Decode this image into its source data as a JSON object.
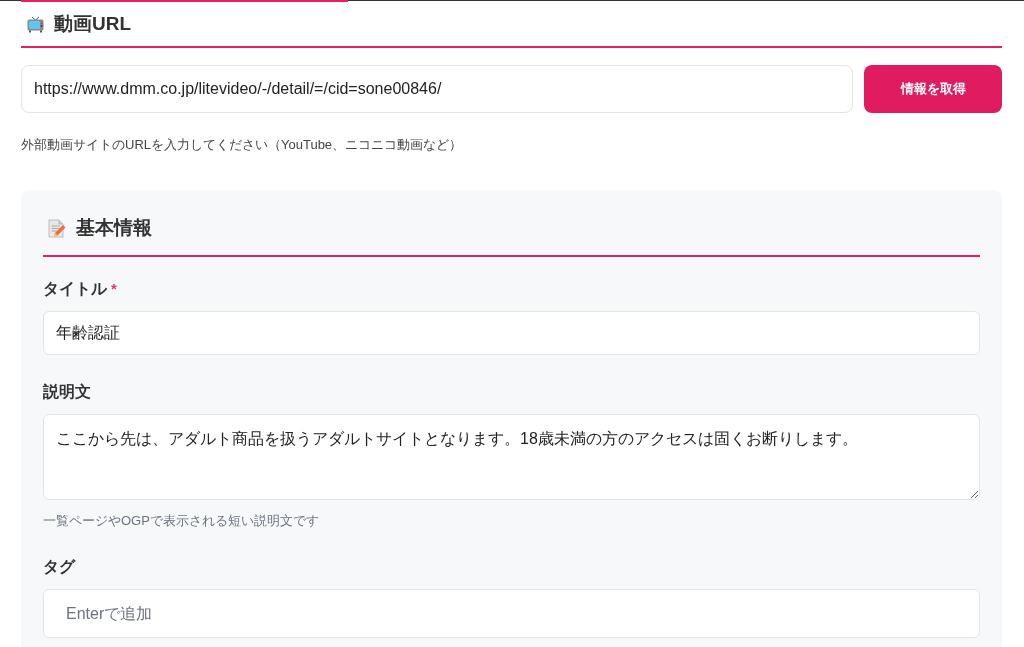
{
  "url_section": {
    "title": "動画URL",
    "url_field": {
      "value": "https://www.dmm.co.jp/litevideo/-/detail/=/cid=sone00846/"
    },
    "fetch_button": "情報を取得",
    "help": "外部動画サイトのURLを入力してください（YouTube、ニコニコ動画など）"
  },
  "basic_info": {
    "title": "基本情報",
    "fields": [
      {
        "kind": "text",
        "label": "タイトル",
        "required_mark": "*",
        "value": "年齢認証"
      },
      {
        "kind": "textarea",
        "label": "説明文",
        "value": "ここから先は、アダルト商品を扱うアダルトサイトとなります。18歳未満の方のアクセスは固くお断りします。",
        "help": "一覧ページやOGPで表示される短い説明文です"
      },
      {
        "kind": "tags",
        "label": "タグ",
        "placeholder": "Enterで追加"
      }
    ]
  }
}
